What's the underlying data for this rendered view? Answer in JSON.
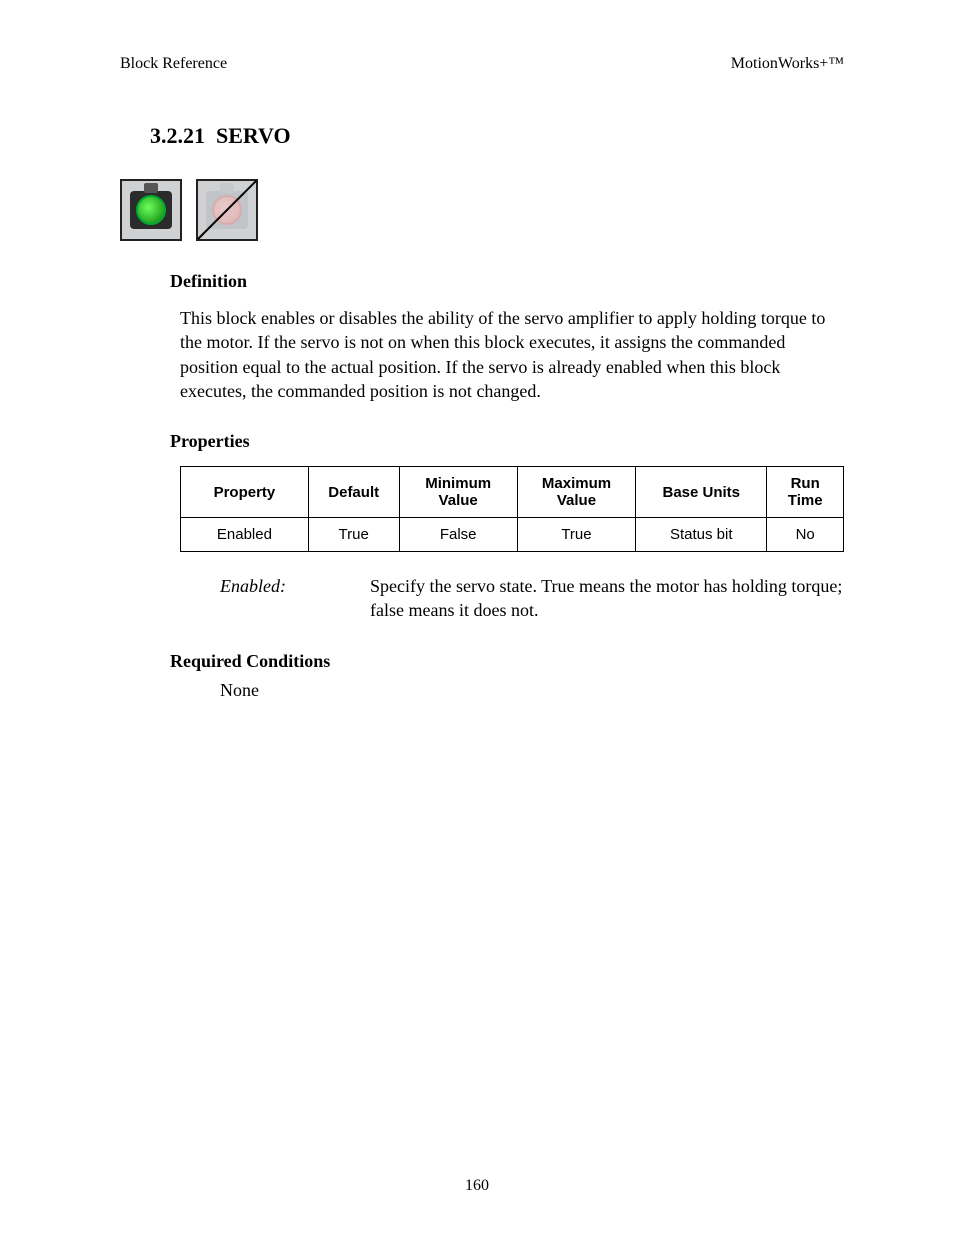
{
  "header": {
    "left": "Block Reference",
    "right": "MotionWorks+™"
  },
  "section": {
    "number": "3.2.21",
    "title": "SERVO"
  },
  "definition": {
    "heading": "Definition",
    "body": "This block enables or disables the ability of the servo amplifier to apply holding torque to the motor.  If the servo is not on when this block executes, it assigns the commanded position equal to the actual position.  If the servo is already enabled when this block executes, the commanded position is not changed."
  },
  "properties": {
    "heading": "Properties",
    "columns": [
      "Property",
      "Default",
      "Minimum Value",
      "Maximum Value",
      "Base Units",
      "Run Time"
    ],
    "rows": [
      {
        "property": "Enabled",
        "default": "True",
        "min": "False",
        "max": "True",
        "base": "Status bit",
        "run": "No"
      }
    ],
    "description": {
      "label": "Enabled:",
      "text": "Specify the servo state.  True means the motor has holding torque; false means it does not."
    }
  },
  "required": {
    "heading": "Required Conditions",
    "body": "None"
  },
  "pageNumber": "160"
}
